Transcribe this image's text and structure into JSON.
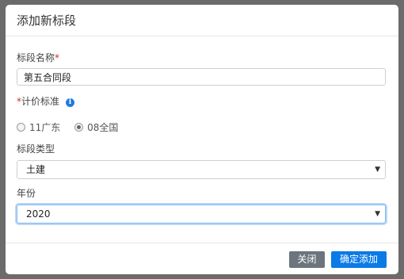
{
  "modal": {
    "title": "添加新标段",
    "section_name": {
      "label": "标段名称",
      "required_mark": "*",
      "value": "第五合同段"
    },
    "pricing_standard": {
      "required_mark": "*",
      "label": "计价标准",
      "info_icon": "info-icon",
      "options": [
        {
          "label": "11广东",
          "checked": false
        },
        {
          "label": "08全国",
          "checked": true
        }
      ]
    },
    "section_type": {
      "label": "标段类型",
      "selected": "土建"
    },
    "year": {
      "label": "年份",
      "selected": "2020"
    },
    "buttons": {
      "close": "关闭",
      "confirm": "确定添加"
    }
  },
  "colors": {
    "primary": "#0a7ae6",
    "secondary": "#6c757d",
    "required": "#c9302c",
    "backdrop": "#6b6b6b"
  }
}
